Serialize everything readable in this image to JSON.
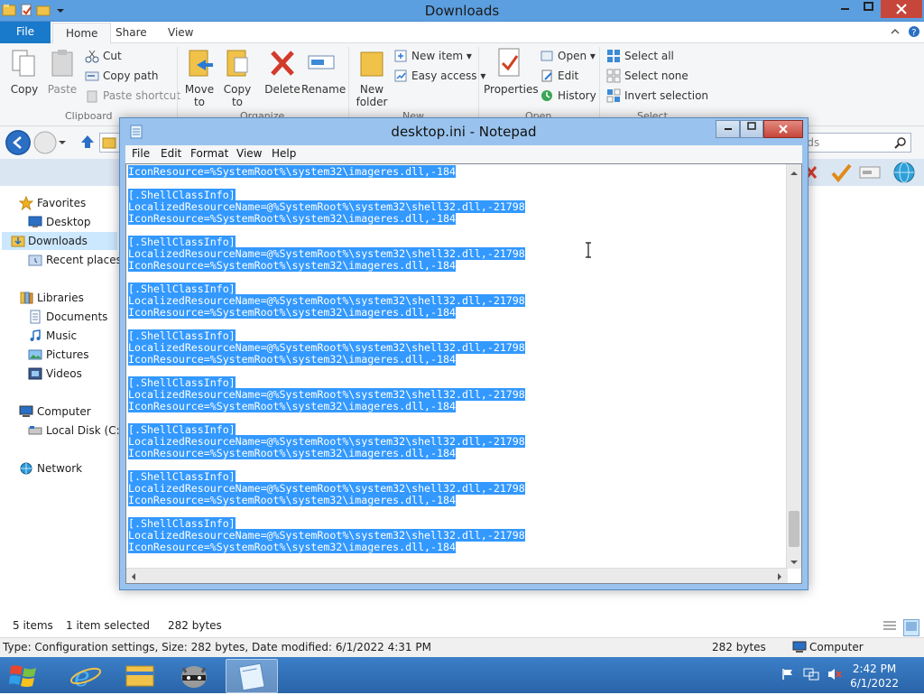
{
  "explorer": {
    "title": "Downloads",
    "tabs": [
      "File",
      "Home",
      "Share",
      "View"
    ],
    "ribbon": {
      "clipboard": {
        "group": "Clipboard",
        "copy": "Copy",
        "paste": "Paste",
        "cut": "Cut",
        "copy_path": "Copy path",
        "paste_shortcut": "Paste shortcut"
      },
      "organize": {
        "group": "Organize",
        "move_to": "Move to",
        "copy_to": "Copy to",
        "delete": "Delete",
        "rename": "Rename"
      },
      "new": {
        "group": "New",
        "new_folder": "New folder",
        "new_item": "New item",
        "easy_access": "Easy access"
      },
      "open": {
        "group": "Open",
        "properties": "Properties",
        "open": "Open",
        "edit": "Edit",
        "history": "History"
      },
      "select": {
        "group": "Select",
        "select_all": "Select all",
        "select_none": "Select none",
        "invert": "Invert selection"
      }
    },
    "search_placeholder": "ads",
    "nav": {
      "favorites": "Favorites",
      "desktop": "Desktop",
      "downloads": "Downloads",
      "recent": "Recent places",
      "libraries": "Libraries",
      "documents": "Documents",
      "music": "Music",
      "pictures": "Pictures",
      "videos": "Videos",
      "computer": "Computer",
      "local_disk": "Local Disk (C:)",
      "network": "Network"
    },
    "status": {
      "items": "5 items",
      "selected": "1 item selected",
      "size": "282 bytes"
    },
    "details": {
      "type_info": "Type: Configuration settings, Size: 282 bytes, Date modified: 6/1/2022 4:31 PM",
      "size": "282 bytes",
      "location": "Computer"
    }
  },
  "notepad": {
    "title": "desktop.ini - Notepad",
    "menu": [
      "File",
      "Edit",
      "Format",
      "View",
      "Help"
    ],
    "first_line": "IconResource=%SystemRoot%\\system32\\imageres.dll,-184",
    "section": "[.ShellClassInfo]",
    "line_a": "LocalizedResourceName=@%SystemRoot%\\system32\\shell32.dll,-21798",
    "line_b": "IconResource=%SystemRoot%\\system32\\imageres.dll,-184"
  },
  "taskbar": {
    "time": "2:42 PM",
    "date": "6/1/2022"
  }
}
